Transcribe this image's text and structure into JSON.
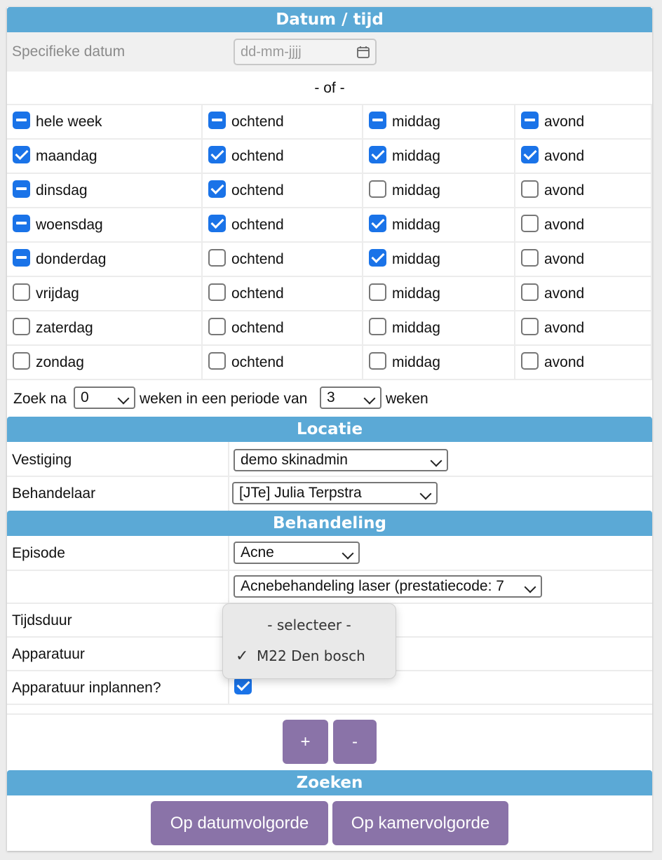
{
  "sections": {
    "datum_tijd": "Datum / tijd",
    "locatie": "Locatie",
    "behandeling": "Behandeling",
    "zoeken": "Zoeken"
  },
  "specific_date": {
    "label": "Specifieke datum",
    "placeholder": "dd-mm-jjjj"
  },
  "or_text": "- of -",
  "schedule": {
    "rows": [
      {
        "day": "hele week",
        "day_state": "mixed",
        "ochtend": "mixed",
        "middag": "mixed",
        "avond": "mixed"
      },
      {
        "day": "maandag",
        "day_state": "checked",
        "ochtend": "checked",
        "middag": "checked",
        "avond": "checked"
      },
      {
        "day": "dinsdag",
        "day_state": "mixed",
        "ochtend": "checked",
        "middag": "unchecked",
        "avond": "unchecked"
      },
      {
        "day": "woensdag",
        "day_state": "mixed",
        "ochtend": "checked",
        "middag": "checked",
        "avond": "unchecked"
      },
      {
        "day": "donderdag",
        "day_state": "mixed",
        "ochtend": "unchecked",
        "middag": "checked",
        "avond": "unchecked"
      },
      {
        "day": "vrijdag",
        "day_state": "unchecked",
        "ochtend": "unchecked",
        "middag": "unchecked",
        "avond": "unchecked"
      },
      {
        "day": "zaterdag",
        "day_state": "unchecked",
        "ochtend": "unchecked",
        "middag": "unchecked",
        "avond": "unchecked"
      },
      {
        "day": "zondag",
        "day_state": "unchecked",
        "ochtend": "unchecked",
        "middag": "unchecked",
        "avond": "unchecked"
      }
    ],
    "labels": {
      "ochtend": "ochtend",
      "middag": "middag",
      "avond": "avond"
    }
  },
  "search_period": {
    "prefix": "Zoek na",
    "weeks_value": "0",
    "middle": "weken in een periode van",
    "period_value": "3",
    "suffix": "weken"
  },
  "locatie": {
    "vestiging_label": "Vestiging",
    "vestiging_value": "demo skinadmin",
    "behandelaar_label": "Behandelaar",
    "behandelaar_value": "[JTe] Julia Terpstra"
  },
  "behandeling": {
    "episode_label": "Episode",
    "episode_value": "Acne",
    "treatment_value": "Acnebehandeling laser (prestatiecode: 7",
    "tijdsduur_label": "Tijdsduur",
    "apparatuur_label": "Apparatuur",
    "inplannen_label": "Apparatuur inplannen?",
    "inplannen_checked": true,
    "add_button": "+",
    "remove_button": "-"
  },
  "dropdown_popup": {
    "options": [
      {
        "label": "- selecteer -",
        "selected": false
      },
      {
        "label": "M22 Den bosch",
        "selected": true
      }
    ]
  },
  "zoeken": {
    "date_order_button": "Op datumvolgorde",
    "room_order_button": "Op kamervolgorde"
  },
  "colors": {
    "header_bg": "#5ba9d6",
    "button_bg": "#8a73a8",
    "checkbox_blue": "#1a73e8"
  }
}
